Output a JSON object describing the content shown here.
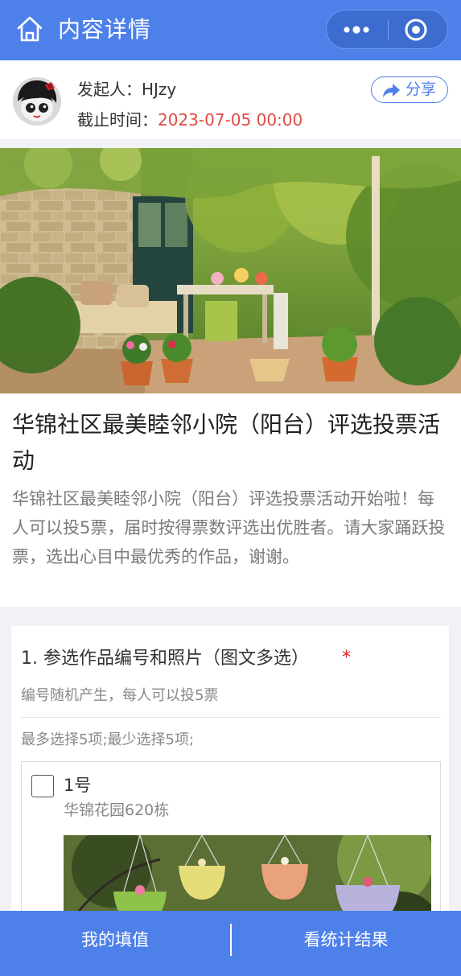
{
  "topbar": {
    "title": "内容详情",
    "home_icon": "home-icon",
    "more_icon": "more-dots-icon",
    "close_icon": "mini-program-close-icon",
    "background": "#4e80ea"
  },
  "info": {
    "initiator": "发起人：HJzy",
    "deadline_label": "截止时间：",
    "deadline_value": "2023-07-05 00:00",
    "deadline_color": "#e14a45",
    "share_label": "分享",
    "share_icon": "share-arrow-icon"
  },
  "vote": {
    "title": "华锦社区最美睦邻小院（阳台）评选投票活动",
    "description": "华锦社区最美睦邻小院（阳台）评选投票活动开始啦！每人可以投5票，届时按得票数评选出优胜者。请大家踊跃投票，选出心目中最优秀的作品，谢谢。"
  },
  "question": {
    "title": "1. 参选作品编号和照片（图文多选）",
    "required_mark": "*",
    "hint": "编号随机产生，每人可以投5票",
    "limit": "最多选择5项;最少选择5项;",
    "options": [
      {
        "label": "1号",
        "sub": "华锦花园620栋",
        "checked": false
      }
    ]
  },
  "bottombar": {
    "my_entry": "我的填值",
    "view_results": "看统计结果"
  }
}
